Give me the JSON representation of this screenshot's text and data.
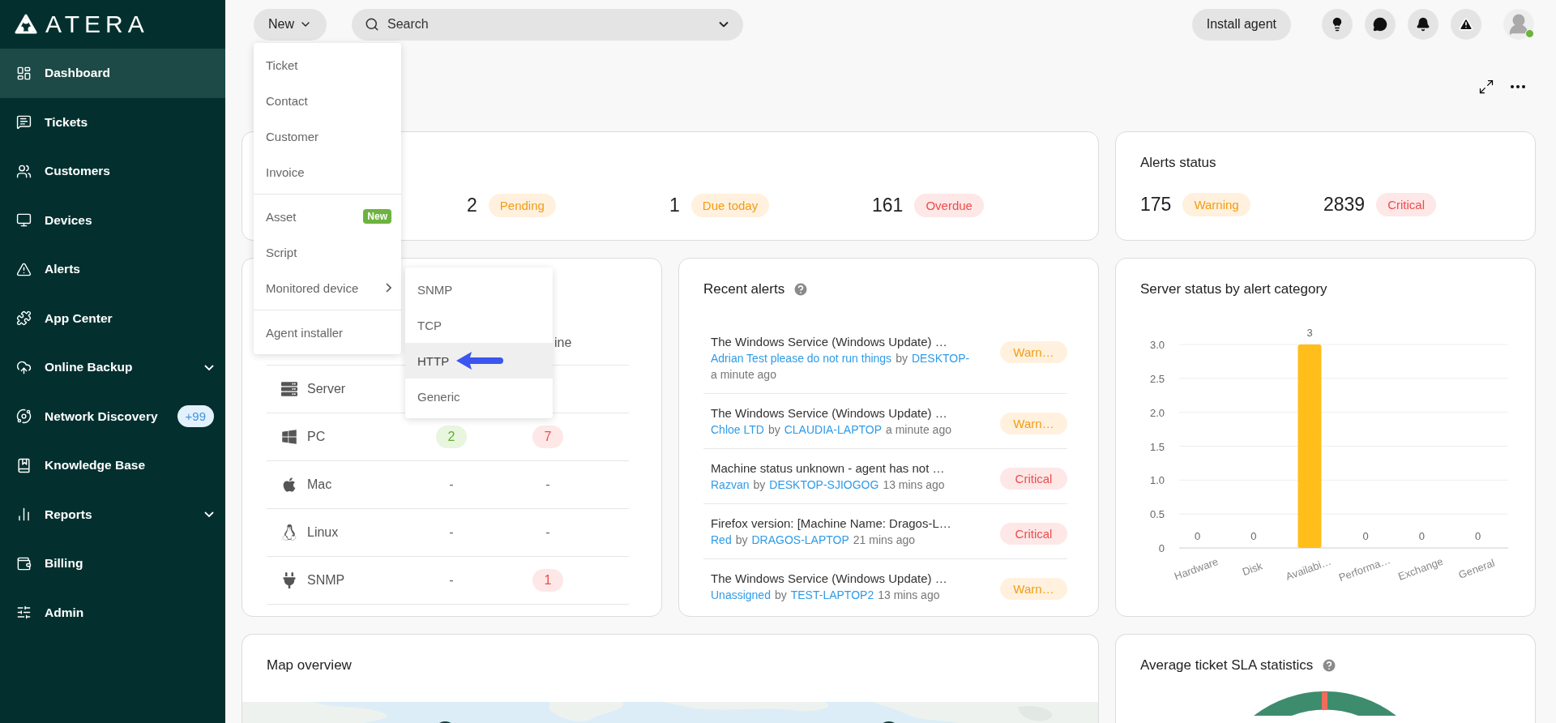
{
  "sidebar": {
    "logo": "ATERA",
    "items": [
      {
        "label": "Dashboard",
        "selected": true
      },
      {
        "label": "Tickets",
        "selected": false
      },
      {
        "label": "Customers",
        "selected": false
      },
      {
        "label": "Devices",
        "selected": false
      },
      {
        "label": "Alerts",
        "selected": false
      },
      {
        "label": "App Center",
        "selected": false
      },
      {
        "label": "Online Backup",
        "selected": false,
        "expandable": true
      },
      {
        "label": "Network Discovery",
        "selected": false,
        "badge": "+99"
      },
      {
        "label": "Knowledge Base",
        "selected": false
      },
      {
        "label": "Reports",
        "selected": false,
        "expandable": true
      },
      {
        "label": "Billing",
        "selected": false
      },
      {
        "label": "Admin",
        "selected": false
      }
    ]
  },
  "topbar": {
    "new_button": "New",
    "search": {
      "placeholder": "Search"
    },
    "install_button": "Install agent",
    "avatar": {
      "online": true
    }
  },
  "new_menu": {
    "groups": [
      {
        "items": [
          {
            "label": "Ticket"
          },
          {
            "label": "Contact"
          },
          {
            "label": "Customer"
          },
          {
            "label": "Invoice"
          }
        ]
      },
      {
        "items": [
          {
            "label": "Asset",
            "badge": "New"
          },
          {
            "label": "Script"
          },
          {
            "label": "Monitored device",
            "has_submenu": true
          }
        ]
      },
      {
        "items": [
          {
            "label": "Agent installer"
          }
        ]
      }
    ]
  },
  "submenu": {
    "items": [
      {
        "label": "SNMP",
        "selected": false
      },
      {
        "label": "TCP",
        "selected": false
      },
      {
        "label": "HTTP",
        "selected": true,
        "pointer": true
      },
      {
        "label": "Generic",
        "selected": false
      }
    ]
  },
  "tickets": {
    "stats": [
      {
        "value": "2",
        "label": "Pending",
        "kind": "warning"
      },
      {
        "value": "1",
        "label": "Due today",
        "kind": "warning"
      },
      {
        "value": "161",
        "label": "Overdue",
        "kind": "critical"
      }
    ]
  },
  "alerts_status": {
    "title": "Alerts status",
    "stats": [
      {
        "value": "175",
        "label": "Warning",
        "kind": "warning"
      },
      {
        "value": "2839",
        "label": "Critical",
        "kind": "critical"
      }
    ]
  },
  "devices": {
    "column_3": "ine",
    "rows": [
      {
        "kind": "server",
        "name": "Server"
      },
      {
        "kind": "windows",
        "name": "PC",
        "online": {
          "text": "2",
          "badge": true
        },
        "offline": {
          "text": "7",
          "badge": true
        }
      },
      {
        "kind": "apple",
        "name": "Mac",
        "online": {
          "text": "-",
          "badge": false
        },
        "offline": {
          "text": "-",
          "badge": false
        }
      },
      {
        "kind": "linux",
        "name": "Linux",
        "online": {
          "text": "-",
          "badge": false
        },
        "offline": {
          "text": "-",
          "badge": false
        }
      },
      {
        "kind": "plug",
        "name": "SNMP",
        "online": {
          "text": "-",
          "badge": false
        },
        "offline": {
          "text": "1",
          "badge": true
        }
      }
    ]
  },
  "recent_alerts": {
    "title": "Recent alerts",
    "items": [
      {
        "title": "The Windows Service (Windows Update) …",
        "customer": "Adrian Test please do not run things",
        "joiner": "by",
        "device": "DESKTOP-",
        "time": "a minute ago",
        "status": "Warn…",
        "kind": "warning"
      },
      {
        "title": "The Windows Service (Windows Update) …",
        "customer": "Chloe LTD",
        "joiner": "by",
        "device": "CLAUDIA-LAPTOP",
        "time": "a minute ago",
        "status": "Warn…",
        "kind": "warning"
      },
      {
        "title": "Machine status unknown - agent has not …",
        "customer": "Razvan",
        "joiner": "by",
        "device": "DESKTOP-SJIOGOG",
        "time": "13 mins ago",
        "status": "Critical",
        "kind": "critical"
      },
      {
        "title": "Firefox version: [Machine Name: Dragos-L…",
        "customer": "Red",
        "joiner": "by",
        "device": "DRAGOS-LAPTOP",
        "time": "21 mins ago",
        "status": "Critical",
        "kind": "critical"
      },
      {
        "title": "The Windows Service (Windows Update) …",
        "customer": "Unassigned",
        "joiner": "by",
        "device": "TEST-LAPTOP2",
        "time": "13 mins ago",
        "status": "Warn…",
        "kind": "warning"
      }
    ]
  },
  "server_status": {
    "title": "Server status by alert category",
    "chart_data": {
      "type": "bar",
      "categories": [
        "Hardware",
        "Disk",
        "Availabi…",
        "Performa…",
        "Exchange",
        "General"
      ],
      "values": [
        0,
        0,
        3,
        0,
        0,
        0
      ],
      "ylim": [
        0,
        3
      ],
      "yticks": [
        0,
        0.5,
        {
          "value": 1,
          "label": "1.0"
        },
        1.5,
        {
          "value": 2,
          "label": "2.0"
        },
        2.5,
        {
          "value": 3,
          "label": "3.0"
        }
      ],
      "data_labels": true,
      "grid": true
    }
  },
  "map": {
    "title": "Map overview"
  },
  "sla": {
    "title": "Average ticket SLA statistics"
  }
}
